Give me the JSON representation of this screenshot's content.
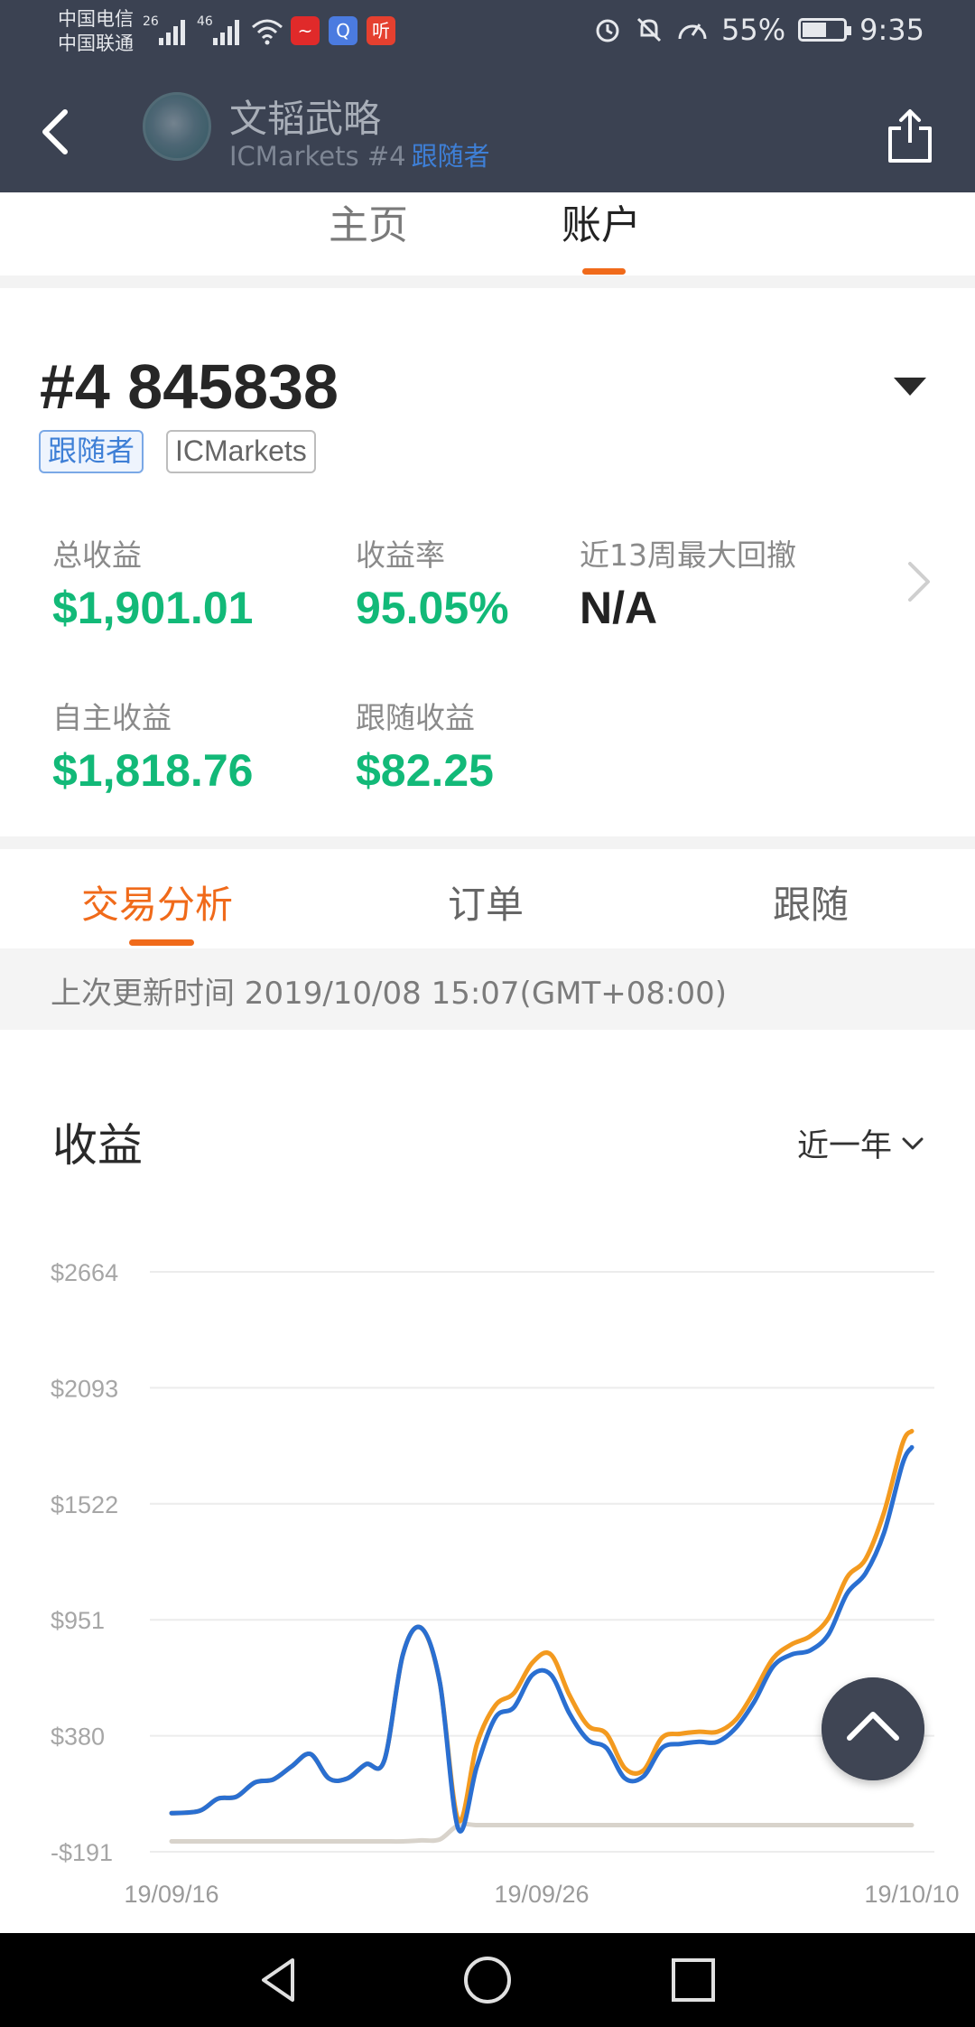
{
  "status_bar": {
    "carrier1": "中国电信",
    "carrier2": "中国联通",
    "net1": "26",
    "net2": "46",
    "app_icon_red": "~",
    "app_icon_blue": "Q",
    "app_icon_listen": "听",
    "battery": "55%",
    "time": "9:35",
    "icons": [
      "alarm-icon",
      "bell-off-icon",
      "speed-icon",
      "battery-icon"
    ]
  },
  "header": {
    "name": "文韬武略",
    "sub_broker": "ICMarkets #4",
    "sub_tag": "跟随者"
  },
  "top_tabs": [
    "主页",
    "账户"
  ],
  "account": {
    "number": "#4 845838",
    "badges": [
      "跟随者",
      "ICMarkets"
    ],
    "stats": [
      {
        "label": "总收益",
        "value": "$1,901.01"
      },
      {
        "label": "收益率",
        "value": "95.05%"
      },
      {
        "label": "近13周最大回撤",
        "value": "N/A"
      },
      {
        "label": "自主收益",
        "value": "$1,818.76"
      },
      {
        "label": "跟随收益",
        "value": "$82.25"
      }
    ]
  },
  "sub_tabs": [
    "交易分析",
    "订单",
    "跟随"
  ],
  "updated": "上次更新时间 2019/10/08 15:07(GMT+08:00)",
  "chart_section": {
    "title": "收益",
    "range": "近一年"
  },
  "chart_data": {
    "type": "line",
    "yticks": [
      "$2664",
      "$2093",
      "$1522",
      "$951",
      "$380",
      "-$191"
    ],
    "ylim": [
      -191,
      2664
    ],
    "xticks": [
      "19/09/16",
      "19/09/26",
      "19/10/10"
    ],
    "x": [
      0,
      0.15,
      0.25,
      0.35,
      0.45,
      0.55,
      0.65,
      0.75,
      0.85,
      0.95,
      1.05,
      1.15,
      1.25,
      1.35,
      1.45,
      1.55,
      1.65,
      1.75,
      1.85,
      1.95,
      2.05,
      2.15,
      2.25,
      2.35,
      2.45,
      2.55,
      2.65,
      2.75,
      2.85,
      2.95,
      3.05,
      3.15,
      3.25,
      3.35,
      3.45,
      3.55,
      3.65,
      3.75,
      3.85,
      3.95,
      4.0
    ],
    "series": [
      {
        "values": [
          -1,
          10,
          70,
          80,
          150,
          165,
          230,
          290,
          170,
          170,
          240,
          260,
          780,
          910,
          640,
          -35,
          340,
          530,
          590,
          740,
          780,
          580,
          430,
          390,
          220,
          210,
          370,
          390,
          400,
          400,
          460,
          600,
          760,
          830,
          870,
          960,
          1160,
          1250,
          1480,
          1820,
          1880
        ],
        "color": "#f39a1f"
      },
      {
        "values": [
          -1,
          10,
          70,
          80,
          150,
          165,
          230,
          290,
          170,
          170,
          240,
          260,
          780,
          910,
          640,
          -80,
          230,
          470,
          520,
          680,
          680,
          490,
          360,
          320,
          170,
          180,
          320,
          340,
          350,
          350,
          420,
          550,
          720,
          780,
          800,
          880,
          1080,
          1180,
          1380,
          1720,
          1800
        ],
        "color": "#2a6fd1"
      },
      {
        "values": [
          -140,
          -140,
          -140,
          -140,
          -140,
          -140,
          -140,
          -140,
          -140,
          -140,
          -140,
          -140,
          -140,
          -135,
          -130,
          -60,
          -60,
          -60,
          -60,
          -60,
          -60,
          -60,
          -60,
          -60,
          -60,
          -60,
          -60,
          -60,
          -60,
          -60,
          -60,
          -60,
          -60,
          -60,
          -60,
          -60,
          -60,
          -60,
          -60,
          -60,
          -60
        ],
        "color": "#d8d3cb"
      }
    ]
  }
}
